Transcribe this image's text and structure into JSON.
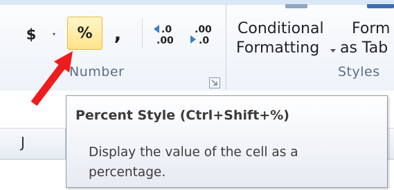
{
  "ribbon": {
    "number_group": {
      "currency_symbol": "$",
      "percent_symbol": "%",
      "comma_symbol": ",",
      "increase_decimal": {
        "top": ".0",
        "bottom": ".00"
      },
      "decrease_decimal": {
        "top": ".00",
        "bottom": ".0"
      },
      "label": "Number"
    },
    "styles_group": {
      "conditional_formatting_line1": "Conditional",
      "conditional_formatting_line2": "Formatting",
      "format_as_table_line1": "Form",
      "format_as_table_line2": "as Tab",
      "label": "Styles"
    }
  },
  "sheet": {
    "column_header": "J"
  },
  "tooltip": {
    "title": "Percent Style (Ctrl+Shift+%)",
    "description_line1": "Display the value of the cell as a",
    "description_line2": "percentage."
  },
  "colors": {
    "highlight_fill": "#ffe38a",
    "highlight_border": "#e9b941",
    "annotation_arrow": "#ee1c1c",
    "group_label": "#5b6c84"
  },
  "icons": {
    "annotation": "red-arrow-icon",
    "dropdown": "chevron-down-icon",
    "launcher": "dialog-launcher-icon"
  }
}
